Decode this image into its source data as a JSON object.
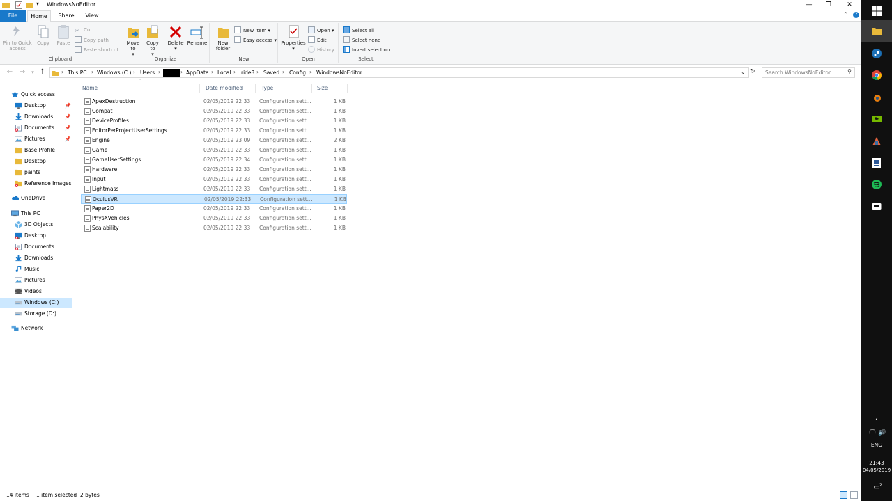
{
  "window": {
    "title": "WindowsNoEditor"
  },
  "ribbon_tabs": [
    {
      "label": "File"
    },
    {
      "label": "Home"
    },
    {
      "label": "Share"
    },
    {
      "label": "View"
    }
  ],
  "ribbon": {
    "clipboard": {
      "label": "Clipboard",
      "pin": "Pin to Quick access",
      "copy": "Copy",
      "paste": "Paste",
      "cut": "Cut",
      "copy_path": "Copy path",
      "paste_shortcut": "Paste shortcut"
    },
    "organize": {
      "label": "Organize",
      "move_to": "Move to",
      "copy_to": "Copy to",
      "delete": "Delete",
      "rename": "Rename"
    },
    "new": {
      "label": "New",
      "new_folder": "New folder",
      "new_item": "New item",
      "easy_access": "Easy access"
    },
    "open": {
      "label": "Open",
      "properties": "Properties",
      "open": "Open",
      "edit": "Edit",
      "history": "History"
    },
    "select": {
      "label": "Select",
      "select_all": "Select all",
      "select_none": "Select none",
      "invert": "Invert selection"
    }
  },
  "address": {
    "crumbs": [
      "This PC",
      "Windows (C:)",
      "Users",
      "",
      "AppData",
      "Local",
      "ride3",
      "Saved",
      "Config",
      "WindowsNoEditor"
    ],
    "search_placeholder": "Search WindowsNoEditor"
  },
  "nav": {
    "quick_access": "Quick access",
    "quick_items": [
      {
        "label": "Desktop",
        "icon": "desktop-icon",
        "pinned": true
      },
      {
        "label": "Downloads",
        "icon": "downloads-icon",
        "pinned": true
      },
      {
        "label": "Documents",
        "icon": "documents-icon",
        "pinned": true
      },
      {
        "label": "Pictures",
        "icon": "pictures-icon",
        "pinned": true
      },
      {
        "label": "Base Profile",
        "icon": "folder-icon",
        "pinned": false
      },
      {
        "label": "Desktop",
        "icon": "folder-icon",
        "pinned": false
      },
      {
        "label": "paints",
        "icon": "folder-icon",
        "pinned": false
      },
      {
        "label": "Reference Images",
        "icon": "folder-icon",
        "pinned": false
      }
    ],
    "onedrive": "OneDrive",
    "this_pc": "This PC",
    "pc_items": [
      {
        "label": "3D Objects",
        "icon": "3d-objects-icon"
      },
      {
        "label": "Desktop",
        "icon": "desktop-icon"
      },
      {
        "label": "Documents",
        "icon": "documents-icon"
      },
      {
        "label": "Downloads",
        "icon": "downloads-icon"
      },
      {
        "label": "Music",
        "icon": "music-icon"
      },
      {
        "label": "Pictures",
        "icon": "pictures-icon"
      },
      {
        "label": "Videos",
        "icon": "videos-icon"
      },
      {
        "label": "Windows (C:)",
        "icon": "drive-icon"
      },
      {
        "label": "Storage (D:)",
        "icon": "drive-icon"
      }
    ],
    "network": "Network"
  },
  "columns": {
    "name": "Name",
    "date": "Date modified",
    "type": "Type",
    "size": "Size"
  },
  "files": [
    {
      "name": "ApexDestruction",
      "date": "02/05/2019 22:33",
      "type": "Configuration sett...",
      "size": "1 KB"
    },
    {
      "name": "Compat",
      "date": "02/05/2019 22:33",
      "type": "Configuration sett...",
      "size": "1 KB"
    },
    {
      "name": "DeviceProfiles",
      "date": "02/05/2019 22:33",
      "type": "Configuration sett...",
      "size": "1 KB"
    },
    {
      "name": "EditorPerProjectUserSettings",
      "date": "02/05/2019 22:33",
      "type": "Configuration sett...",
      "size": "1 KB"
    },
    {
      "name": "Engine",
      "date": "02/05/2019 23:09",
      "type": "Configuration sett...",
      "size": "2 KB"
    },
    {
      "name": "Game",
      "date": "02/05/2019 22:33",
      "type": "Configuration sett...",
      "size": "1 KB"
    },
    {
      "name": "GameUserSettings",
      "date": "02/05/2019 22:34",
      "type": "Configuration sett...",
      "size": "1 KB"
    },
    {
      "name": "Hardware",
      "date": "02/05/2019 22:33",
      "type": "Configuration sett...",
      "size": "1 KB"
    },
    {
      "name": "Input",
      "date": "02/05/2019 22:33",
      "type": "Configuration sett...",
      "size": "1 KB"
    },
    {
      "name": "Lightmass",
      "date": "02/05/2019 22:33",
      "type": "Configuration sett...",
      "size": "1 KB"
    },
    {
      "name": "OculusVR",
      "date": "02/05/2019 22:33",
      "type": "Configuration sett...",
      "size": "1 KB"
    },
    {
      "name": "Paper2D",
      "date": "02/05/2019 22:33",
      "type": "Configuration sett...",
      "size": "1 KB"
    },
    {
      "name": "PhysXVehicles",
      "date": "02/05/2019 22:33",
      "type": "Configuration sett...",
      "size": "1 KB"
    },
    {
      "name": "Scalability",
      "date": "02/05/2019 22:33",
      "type": "Configuration sett...",
      "size": "1 KB"
    }
  ],
  "status": {
    "count": "14 items",
    "selection": "1 item selected  2 bytes"
  },
  "taskbar": {
    "language": "ENG",
    "time": "21:43",
    "date": "04/05/2019"
  },
  "colors": {
    "accent": "#1979ca",
    "selection": "#cce8ff",
    "taskbar": "#101010"
  }
}
